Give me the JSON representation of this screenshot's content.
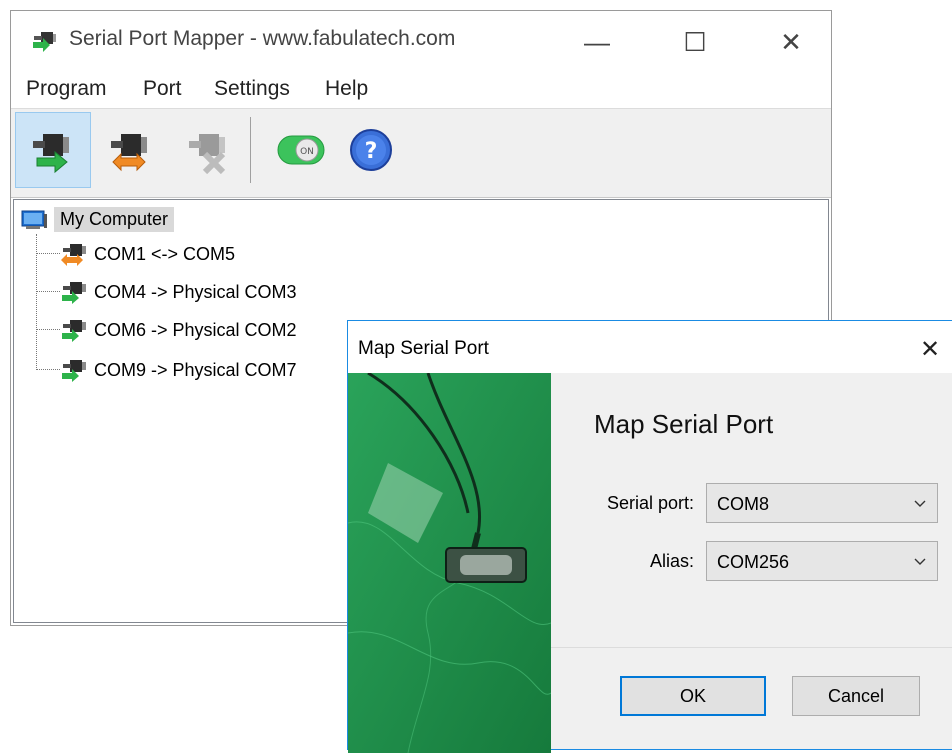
{
  "main_window": {
    "title": "Serial Port Mapper - www.fabulatech.com",
    "controls": {
      "minimize": "—",
      "maximize": "☐",
      "close": "✕"
    }
  },
  "menu": [
    "Program",
    "Port",
    "Settings",
    "Help"
  ],
  "toolbar": {
    "buttons": [
      {
        "icon": "map-to-physical-icon",
        "active": true
      },
      {
        "icon": "map-pair-icon",
        "active": false
      },
      {
        "icon": "remove-mapping-icon",
        "active": false
      },
      {
        "icon": "on-toggle-icon",
        "label": "ON"
      },
      {
        "icon": "help-icon",
        "label": "?"
      }
    ]
  },
  "tree": {
    "root": "My Computer",
    "items": [
      {
        "label": "COM1 <-> COM5",
        "type": "pair"
      },
      {
        "label": "COM4 -> Physical COM3",
        "type": "physical"
      },
      {
        "label": "COM6 -> Physical COM2",
        "type": "physical"
      },
      {
        "label": "COM9 -> Physical COM7",
        "type": "physical"
      }
    ]
  },
  "dialog": {
    "title": "Map Serial Port",
    "close": "✕",
    "heading": "Map Serial Port",
    "serial_port_label": "Serial port:",
    "serial_port_value": "COM8",
    "alias_label": "Alias:",
    "alias_value": "COM256",
    "ok_label": "OK",
    "cancel_label": "Cancel"
  },
  "colors": {
    "accent": "#0078d7",
    "selection": "#cce4f7",
    "dialog_image": "#1f8f48"
  }
}
